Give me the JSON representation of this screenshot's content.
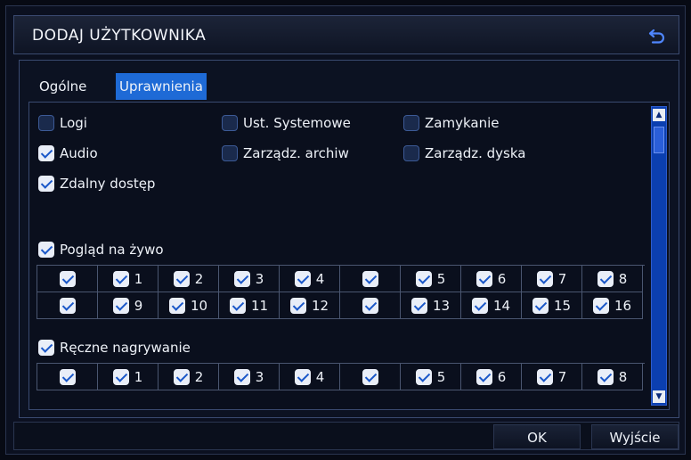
{
  "window": {
    "title": "DODAJ UŻYTKOWNIKA"
  },
  "icons": {
    "back": "return-arrow-icon",
    "scroll_up": "scroll-up-arrow-icon",
    "scroll_down": "scroll-down-arrow-icon",
    "checkbox": "checkbox-icon"
  },
  "colors": {
    "accent": "#1e6ad6",
    "background": "#0b1020",
    "check": "#e9eef8"
  },
  "tabs": [
    {
      "label": "Ogólne",
      "active": false
    },
    {
      "label": "Uprawnienia",
      "active": true
    }
  ],
  "permissions": [
    {
      "label": "Logi",
      "checked": false
    },
    {
      "label": "Ust. Systemowe",
      "checked": false
    },
    {
      "label": "Zamykanie",
      "checked": false
    },
    {
      "label": "Audio",
      "checked": true
    },
    {
      "label": "Zarządz. archiw",
      "checked": false
    },
    {
      "label": "Zarządz. dyska",
      "checked": false
    },
    {
      "label": "Zdalny dostęp",
      "checked": true
    }
  ],
  "live_view": {
    "label": "Pogląd na żywo",
    "checked": true,
    "rows": [
      [
        {
          "label": "",
          "checked": true
        },
        {
          "label": "1",
          "checked": true
        },
        {
          "label": "2",
          "checked": true
        },
        {
          "label": "3",
          "checked": true
        },
        {
          "label": "4",
          "checked": true
        },
        {
          "label": "",
          "checked": true
        },
        {
          "label": "5",
          "checked": true
        },
        {
          "label": "6",
          "checked": true
        },
        {
          "label": "7",
          "checked": true
        },
        {
          "label": "8",
          "checked": true
        }
      ],
      [
        {
          "label": "",
          "checked": true
        },
        {
          "label": "9",
          "checked": true
        },
        {
          "label": "10",
          "checked": true
        },
        {
          "label": "11",
          "checked": true
        },
        {
          "label": "12",
          "checked": true
        },
        {
          "label": "",
          "checked": true
        },
        {
          "label": "13",
          "checked": true
        },
        {
          "label": "14",
          "checked": true
        },
        {
          "label": "15",
          "checked": true
        },
        {
          "label": "16",
          "checked": true
        }
      ]
    ]
  },
  "manual_recording": {
    "label": "Ręczne nagrywanie",
    "checked": true,
    "rows": [
      [
        {
          "label": "",
          "checked": true
        },
        {
          "label": "1",
          "checked": true
        },
        {
          "label": "2",
          "checked": true
        },
        {
          "label": "3",
          "checked": true
        },
        {
          "label": "4",
          "checked": true
        },
        {
          "label": "",
          "checked": true
        },
        {
          "label": "5",
          "checked": true
        },
        {
          "label": "6",
          "checked": true
        },
        {
          "label": "7",
          "checked": true
        },
        {
          "label": "8",
          "checked": true
        }
      ]
    ]
  },
  "buttons": {
    "ok": "OK",
    "exit": "Wyjście"
  }
}
